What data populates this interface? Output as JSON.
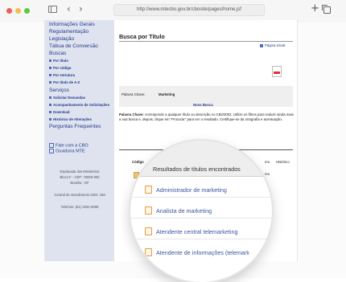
{
  "browser": {
    "url": "http://www.mtecbo.gov.br/cbosite/pages/home.jsf",
    "back_icon": "chevron-left-icon",
    "forward_icon": "chevron-right-icon",
    "sidebar_toggle_icon": "sidebar-icon",
    "new_tab_symbol": "+",
    "tabs_icon": "tabs-icon"
  },
  "sidebar": {
    "items": [
      {
        "label": "Informações Gerais",
        "style": "big"
      },
      {
        "label": "Regulamentação",
        "style": "big"
      },
      {
        "label": "Legislação",
        "style": "big"
      },
      {
        "label": "Tábua de Conversão",
        "style": "big"
      },
      {
        "label": "Buscas",
        "style": "big"
      },
      {
        "label": "Por título",
        "style": "small"
      },
      {
        "label": "Por código",
        "style": "small"
      },
      {
        "label": "Por estrutura",
        "style": "small"
      },
      {
        "label": "Por título de A-Z",
        "style": "small"
      },
      {
        "label": "Serviços",
        "style": "big"
      },
      {
        "label": "Solicitar Demandas",
        "style": "small"
      },
      {
        "label": "Acompanhamento de Solicitações",
        "style": "small"
      },
      {
        "label": "Download",
        "style": "small"
      },
      {
        "label": "Histórico de Alterações",
        "style": "small"
      },
      {
        "label": "Perguntas Frequentes",
        "style": "big"
      }
    ],
    "contact": [
      "Fale com a CBO",
      "Ouvidoria MTE"
    ],
    "address": [
      "Esplanada dos Ministérios",
      "Bloco F - CEP: 70059-900",
      "Brasília - DF"
    ],
    "central": "Central de Atendimento CBO: 158",
    "phone": "Telefone: (61) 2031-6000"
  },
  "main": {
    "title": "Busca por Título",
    "home_link": "Página inicial",
    "keyword_label": "Palavra Chave:",
    "keyword_value": "Marketing",
    "new_search": "Nova Busca",
    "help_label": "Palavra Chave:",
    "help_text_1": "corresponde a qualquer título ou descrição no CBO2002. Utilize os filtros para reduzir",
    "help_text_2": "ainda mais a sua busca e, depois, clique em \"Procurar\" para ver o resultado. Certifique-se da ortografia e",
    "help_text_3": "acentuação.",
    "col_code": "Código",
    "col_title_fragment": "Títu",
    "col_type_fragment": "mo",
    "col_history": "Histórico",
    "row_type_fragments": [
      "mo",
      "mo",
      "mo",
      "mo"
    ]
  },
  "results": {
    "heading": "Resultados de títulos encontrados",
    "items": [
      "Administrador de marketing",
      "Analista de marketing",
      "Atendente central telemarketing",
      "Atendente de informações (telemark"
    ]
  }
}
